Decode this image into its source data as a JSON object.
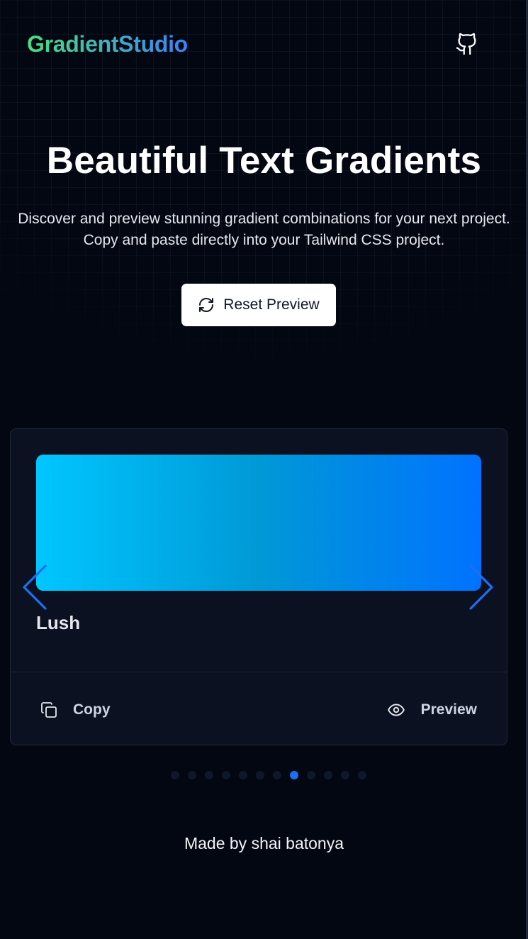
{
  "header": {
    "logo_text": "GradientStudio",
    "github_icon": "github-icon"
  },
  "hero": {
    "title": "Beautiful Text Gradients",
    "subtitle_line1": "Discover and preview stunning gradient combinations for your next project.",
    "subtitle_line2": "Copy and paste directly into your Tailwind CSS project.",
    "reset_button": {
      "label": "Reset Preview",
      "icon": "refresh-icon"
    }
  },
  "carousel": {
    "prev_icon": "chevron-left-icon",
    "next_icon": "chevron-right-icon",
    "active_index": 7,
    "dot_count": 12,
    "current_card": {
      "name": "Lush",
      "gradient_colors": [
        "#00c6ff",
        "#0099d6",
        "#0072ff"
      ],
      "copy_label": "Copy",
      "copy_icon": "copy-icon",
      "preview_label": "Preview",
      "preview_icon": "eye-icon"
    }
  },
  "footer": {
    "text": "Made by shai batonya"
  },
  "colors": {
    "background": "#030712",
    "card_background": "#0b1120",
    "accent": "#1d6ff2",
    "logo_gradient_start": "#4ade80",
    "logo_gradient_end": "#3b82f6"
  }
}
